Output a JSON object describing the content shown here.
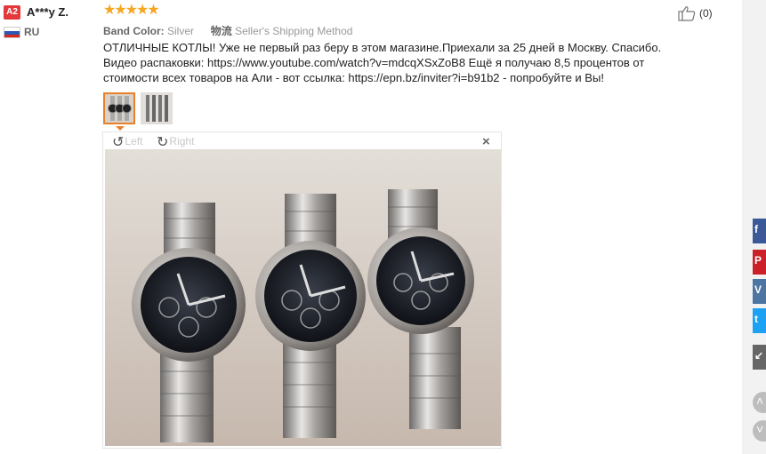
{
  "reviewer": {
    "level": "A2",
    "name": "A***y Z.",
    "country": "RU"
  },
  "review": {
    "stars": [
      "★",
      "★",
      "★",
      "★",
      "★"
    ],
    "rating": 5,
    "attr1_key": "Band Color:",
    "attr1_value": "Silver",
    "attr2_key": "物流",
    "attr2_value": "Seller's Shipping Method",
    "text": "ОТЛИЧНЫЕ КОТЛЫ! Уже не первый раз беру в этом магазине.Приехали за 25 дней в Москву. Спасибо. Видео распаковки: https://www.youtube.com/watch?v=mdcqXSxZoB8 Ещё я получаю 8,5 процентов от стоимости всех товаров на Али - вот ссылка: https://epn.bz/inviter?i=b91b2 - попробуйте и Вы!",
    "helpful_count": "(0)"
  },
  "viewer": {
    "rotate_left": "Left",
    "rotate_right": "Right",
    "close_symbol": "×"
  },
  "icons": {
    "thumbs_up": "thumbs-up-icon",
    "rotate_left": "rotate-left-icon",
    "rotate_right": "rotate-right-icon",
    "close": "close-icon"
  },
  "share": {
    "facebook": "f",
    "pinterest": "P",
    "vk": "V",
    "twitter": "t"
  },
  "colors": {
    "accent": "#e8802c",
    "star": "#f5a623",
    "badge": "#e4393c"
  }
}
